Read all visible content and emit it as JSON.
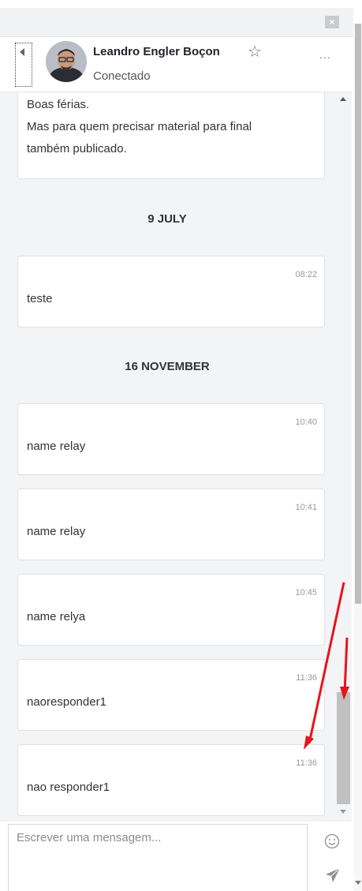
{
  "header": {
    "contact_name": "Leandro Engler Boçon",
    "status": "Conectado",
    "more_label": "...",
    "close_label": "×"
  },
  "messages": {
    "first": {
      "lines": [
        "Boas férias.",
        "Mas para quem precisar material para final",
        "também publicado."
      ]
    },
    "dates": [
      "9 JULY",
      "16 NOVEMBER"
    ],
    "items": [
      {
        "time": "08:22",
        "text": "teste"
      },
      {
        "time": "10:40",
        "text": "name relay"
      },
      {
        "time": "10:41",
        "text": "name relay"
      },
      {
        "time": "10:45",
        "text": "name relya"
      },
      {
        "time": "11:36",
        "text": "naoresponder1"
      },
      {
        "time": "11:36",
        "text": "nao responder1"
      }
    ]
  },
  "composer": {
    "placeholder": "Escrever uma mensagem...",
    "value": ""
  },
  "colors": {
    "annotation_arrow": "#e8141b",
    "panel_bg": "#f3f4f6"
  }
}
